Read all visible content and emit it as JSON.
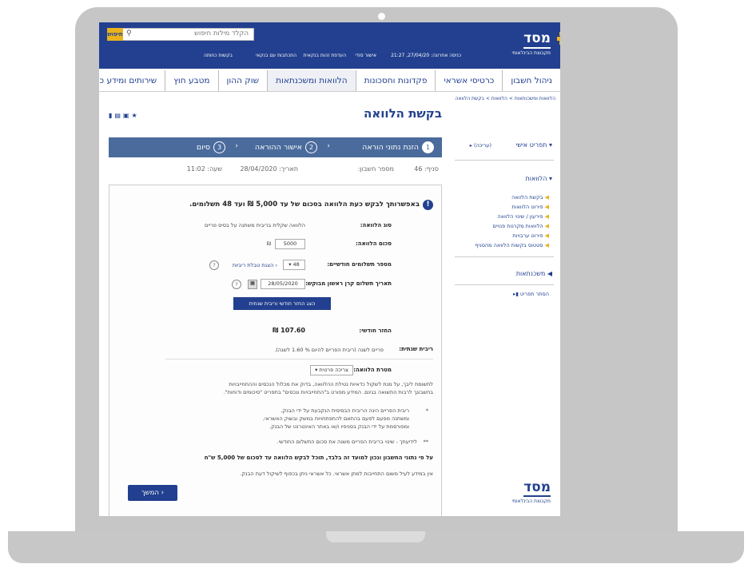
{
  "brand": {
    "name": "מסד",
    "subtitle": "מקבוצת הבינלאומי",
    "colors": {
      "primary": "#22408f",
      "accent": "#e9b31e",
      "stepper": "#4a6b9c"
    }
  },
  "header": {
    "search_placeholder": "הקלד מילות חיפוש",
    "search_button": "חיפוש",
    "last_login": "כניסה אחרונה: 27/04/20, 21:27",
    "links": [
      "אישור סודי",
      "העדפת זהות בנקאית",
      "התכתבות עם בנקאי",
      "בקשות כחותה"
    ]
  },
  "nav": {
    "items": [
      "ניהול חשבון",
      "כרטיסי אשראי",
      "פקדונות וחסכונות",
      "הלוואות ומשכנתאות",
      "שוק ההון",
      "מטבע חוץ",
      "שירותים ומידע כללי"
    ]
  },
  "breadcrumb": "הלוואות ומשכנתאות > הלוואות > בקשת הלוואה",
  "page": {
    "title": "בקשת הלוואה",
    "tool_icons": [
      "print-icon",
      "email-icon",
      "save-icon",
      "star-icon"
    ]
  },
  "sidebar": {
    "profile": "תפריט אישי",
    "profile_edit": "(עריכה)",
    "loans": "הלוואות",
    "loan_items": [
      "בקשת הלוואה",
      "פירוט הלוואות",
      "פירעון / שינוי הלוואה",
      "הלוואות מקרנות פנויים",
      "פירוט ערבויות",
      "סטטוס בקשות הלוואה מהסניף"
    ],
    "mortgages": "משכנתאות",
    "hide_menu": "הסתר תפריט"
  },
  "stepper": {
    "steps": [
      {
        "num": "1",
        "label": "הזנת נתוני הוראה"
      },
      {
        "num": "2",
        "label": "אישור ההוראה"
      },
      {
        "num": "3",
        "label": "סיום"
      }
    ]
  },
  "account": {
    "branch_label": "סניף:",
    "branch": "46",
    "account_label": "מספר חשבון:",
    "account": "",
    "date_label": "תאריך:",
    "date": "28/04/2020",
    "time_label": "שעה:",
    "time": "11:02"
  },
  "form": {
    "headline": "באפשרותך לבקש כעת הלוואה בסכום של עד 5,000 ₪ ועד 48 תשלומים.",
    "loan_type_label": "סוג הלוואה:",
    "loan_type": "הלוואה שקלית בריבית משתנה על בסיס פריים",
    "amount_label": "סכום הלוואה:",
    "amount": "5000",
    "currency": "₪",
    "payments_label": "מספר תשלומים חודשיים:",
    "payments": "48",
    "rate_table_link": "הצגת טבלת ריביות",
    "first_payment_label": "תאריך תשלום קרן ראשון מבוקש:",
    "first_payment": "28/05/2020",
    "calc_button": "הצג החזר חודשי וריבית שנתית",
    "monthly_label": "החזר חודשי:",
    "monthly": "107.60 ₪",
    "annual_rate_label": "ריבית שנתית:",
    "annual_rate": "פריים לשנה (ריבית הפריים להיום % 1.60 לשנה).",
    "purpose_label": "מטרת הלוואה:",
    "purpose": "צריכה פרטית",
    "note1": "לתשומת ליבך, על מנת לשקול כדאיות נטילת ההלוואה, בדוק את מכלול הנכסים וההתחייבויות",
    "note2": "בחשבונך לרבות התשואה בגינם. המידע מפורט ב\"התחייבויות ונכסים\" בתפריט \"סיכומים ודוחות\".",
    "prime1": "ריבית הפריים הינה הריבית הבסיסית הנקבעת על ידי הבנק,",
    "prime2": "ומשתנה מפעם לפעם בהתאם להתפתחויות במשק ובשוק האשראי,",
    "prime3": "ומפורסמת על ידי הבנק בסניפיו ו/או באתר האינטרנט של הבנק.",
    "fyi": "לידיעתך - שינוי בריבית הפריים משנה את סכום התשלום החודשי.",
    "eligibility": "על פי נתוני החשבון ונכון למועד זה בלבד, תוכל לבקש הלוואה עד לסכום של 5,000 ש\"ח",
    "disclaimer": "אין במידע לעיל משום התחייבות למתן אשראי. כל אשראי ניתן בכפוף לשיקול דעת הבנק.",
    "next_button": "המשך"
  }
}
